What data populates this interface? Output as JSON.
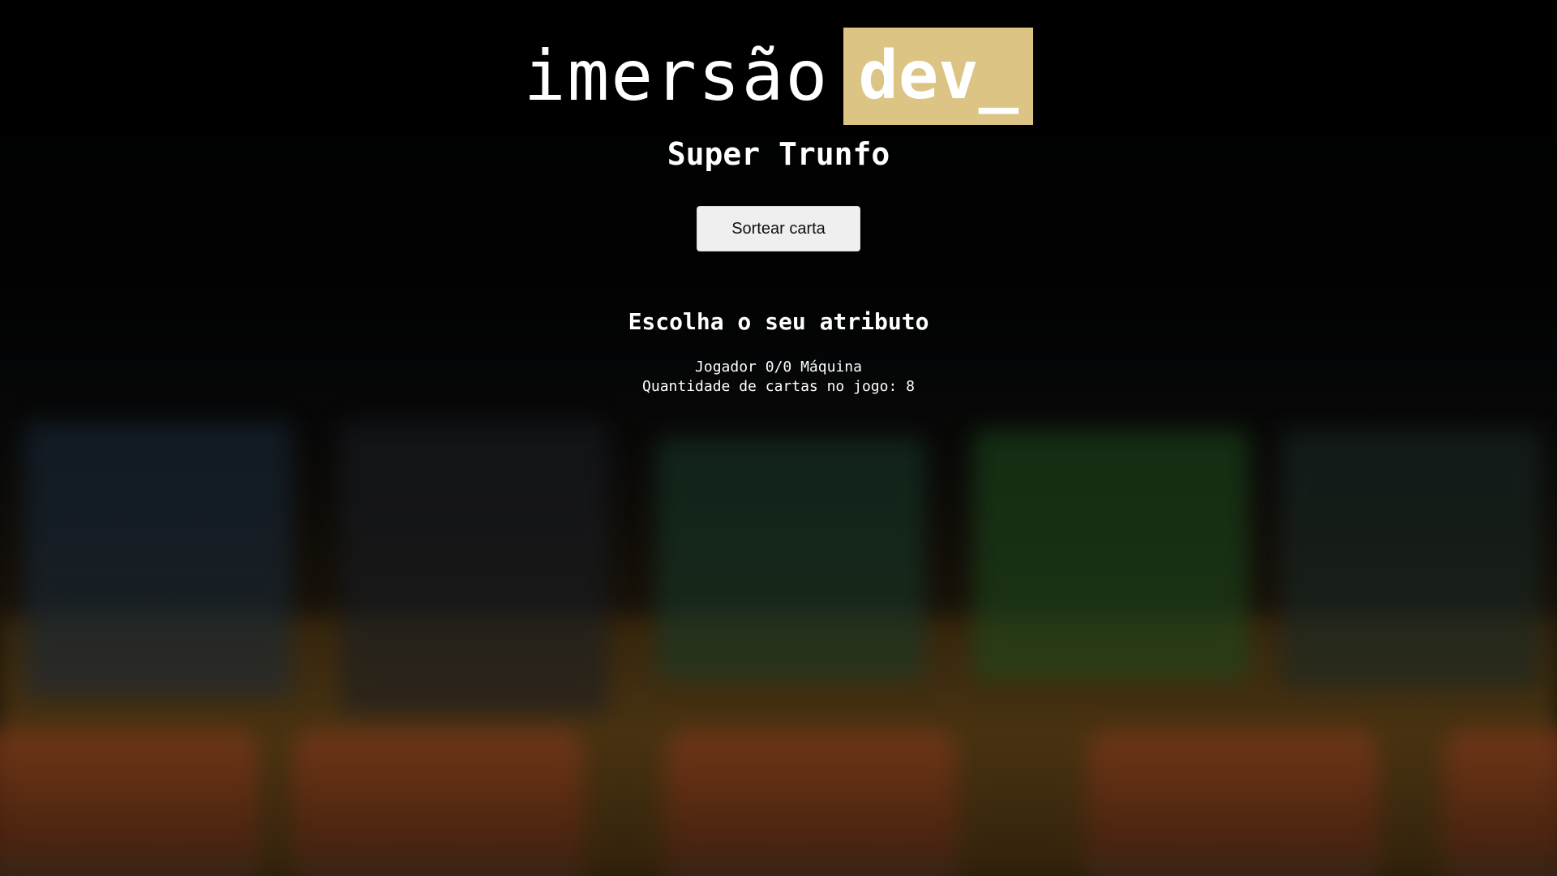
{
  "logo": {
    "text": "imersão",
    "badge": "dev_",
    "badge_color": "#dcc485"
  },
  "subtitle": "Super Trunfo",
  "draw_button": {
    "label": "Sortear carta"
  },
  "attribute_section": {
    "title": "Escolha o seu atributo"
  },
  "scoreboard": {
    "placar": "Jogador 0/0 Máquina",
    "cards_in_game": "Quantidade de cartas no jogo: 8"
  }
}
